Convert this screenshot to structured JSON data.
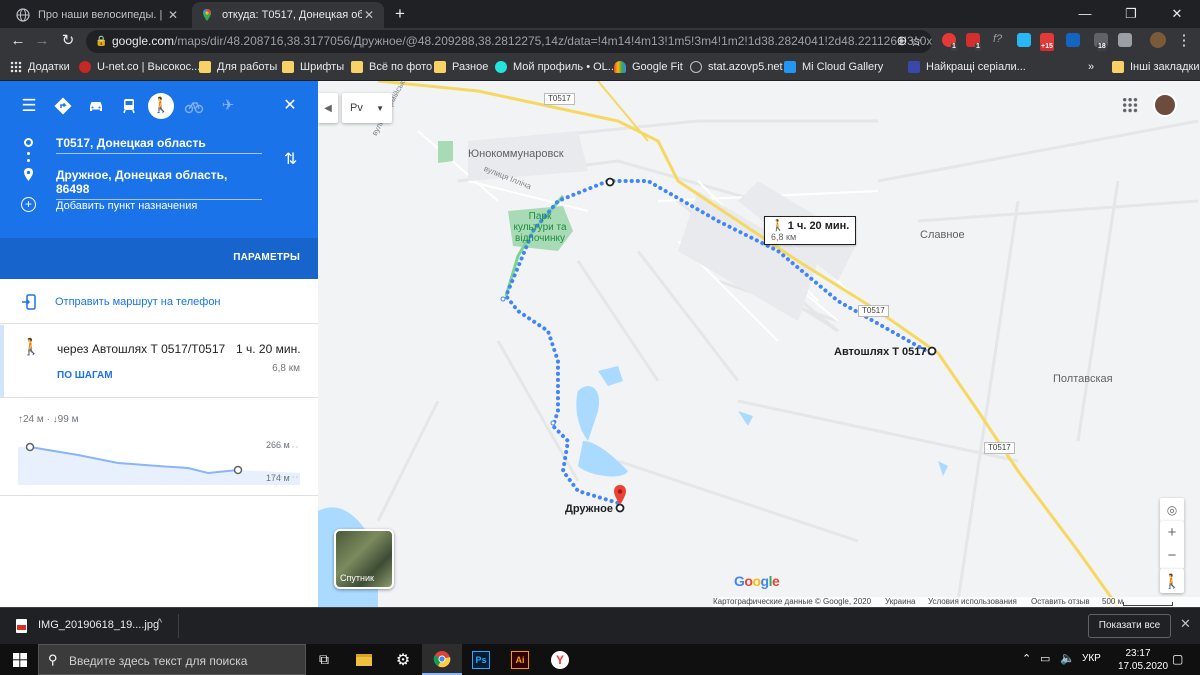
{
  "browser": {
    "tabs": [
      {
        "title": "Про наши велосипеды. | Страни",
        "active": false
      },
      {
        "title": "откуда: Т0517, Донецкая област",
        "active": true
      }
    ],
    "url_host": "google.com",
    "url_path": "/maps/dir/48.208716,38.3177056/Дружное/@48.209288,38.2812275,14z/data=!4m14!4m13!1m5!3m4!1m2!1d38.2824041!2d48.2211261!3s0x40...",
    "extension_badges": [
      "1",
      "1",
      "+15",
      "18"
    ],
    "profile_initial": "A"
  },
  "bookmarks": [
    {
      "label": "Додатки",
      "icon": "apps-grid-icon"
    },
    {
      "label": "U-net.co | Высокос...",
      "icon": "unet-icon"
    },
    {
      "label": "Для работы",
      "icon": "folder-icon"
    },
    {
      "label": "Шрифты",
      "icon": "folder-icon"
    },
    {
      "label": "Всё по фото",
      "icon": "folder-icon"
    },
    {
      "label": "Разное",
      "icon": "folder-icon"
    },
    {
      "label": "Мой профиль • OL...",
      "icon": "olx-icon"
    },
    {
      "label": "Google Fit",
      "icon": "google-fit-icon"
    },
    {
      "label": "stat.azovp5.net",
      "icon": "globe-icon"
    },
    {
      "label": "Mi Cloud Gallery",
      "icon": "mi-cloud-icon"
    },
    {
      "label": "Найкращі серіали...",
      "icon": "ua-icon"
    }
  ],
  "bookmarks_more": "»",
  "bookmarks_other": "Інші закладки",
  "directions": {
    "origin": "Т0517, Донецкая область",
    "destination": "Дружное, Донецкая область, 86498",
    "add_destination": "Добавить пункт назначения",
    "params_label": "ПАРАМЕТРЫ",
    "send_to_phone": "Отправить маршрут на телефон",
    "route_via": "через Автошлях Т 0517/Т0517",
    "route_time": "1 ч. 20 мин.",
    "route_distance": "6,8 км",
    "steps_link": "ПО ШАГАМ",
    "elevation_summary_up": "24 м",
    "elevation_summary_down": "99 м",
    "elevation_max": "266 м",
    "elevation_min": "174 м"
  },
  "map": {
    "layer_selector_label": "Рv",
    "satellite_label": "Спутник",
    "logo": "Google",
    "callout_time": "1 ч. 20 мин.",
    "callout_distance": "6,8 км",
    "labels": {
      "city": "Юнокоммунаровск",
      "park": "Парк культури та відпочинку",
      "slavnoe": "Славное",
      "poltavskaya": "Полтавская",
      "highway_label": "Автошлях Т 0517",
      "destination_label": "Дружное",
      "street_armeiska": "вулиця Армійська",
      "street_illicha": "вулиця Ілліча"
    },
    "road_shields": [
      "Т0517",
      "Т0517",
      "Т0517"
    ],
    "attribution": "Картографические данные © Google, 2020",
    "attribution_country": "Украина",
    "terms": "Условия использования",
    "feedback": "Оставить отзыв",
    "scale": "500 м"
  },
  "downloads": {
    "file_name": "IMG_20190618_19....jpg",
    "show_all": "Показати все"
  },
  "taskbar": {
    "search_placeholder": "Введите здесь текст для поиска",
    "language": "УКР",
    "time": "23:17",
    "date": "17.05.2020"
  },
  "colors": {
    "maps_blue": "#1a73e8",
    "route_dots": "#4285f4",
    "highway_yellow": "#f6d860",
    "water": "#aadaff",
    "park_green": "#a8dab5"
  }
}
